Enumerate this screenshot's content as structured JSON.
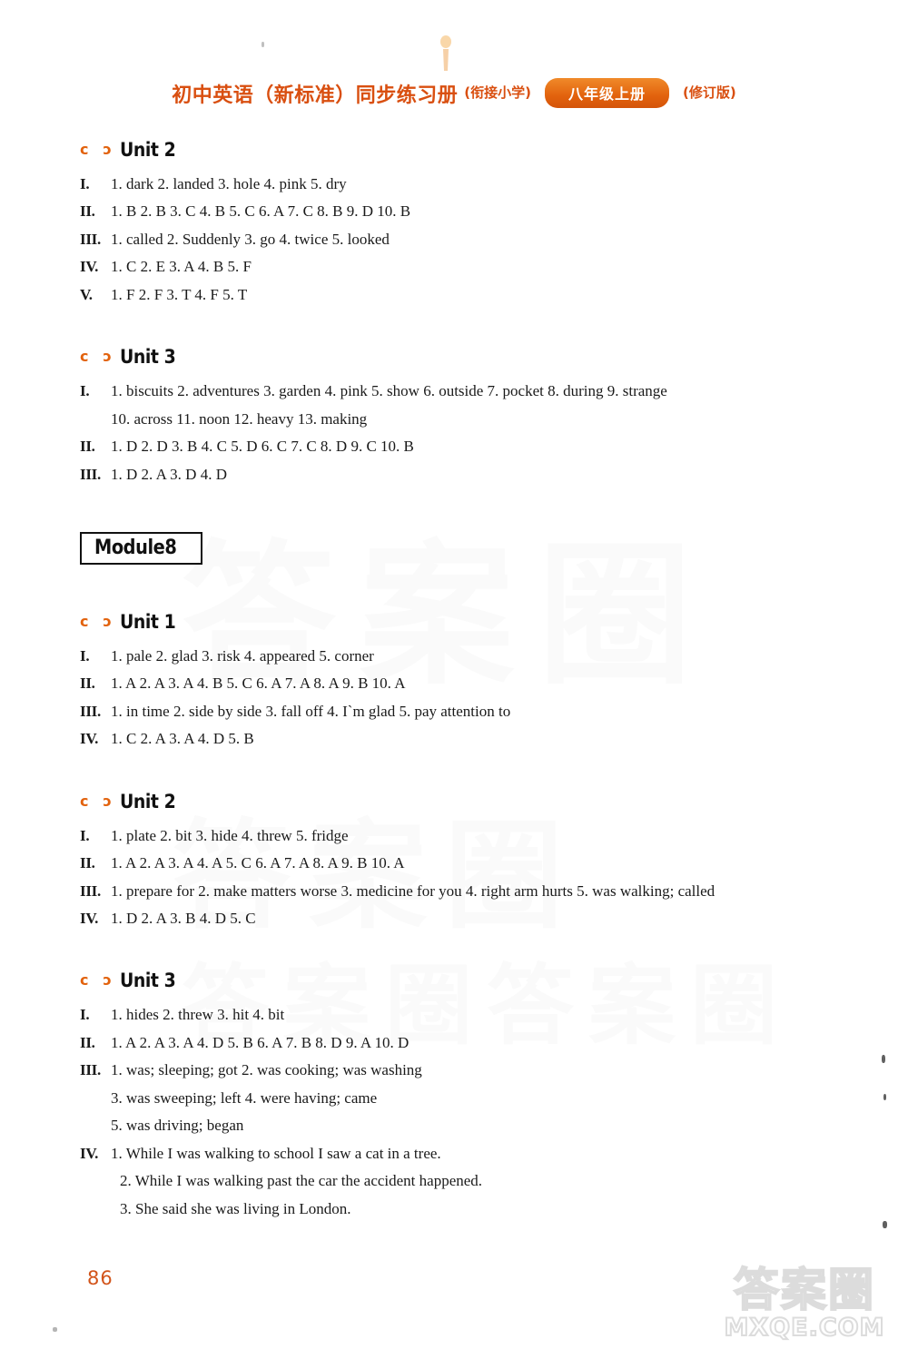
{
  "header": {
    "title_main": "初中英语（新标准）同步练习册",
    "title_sub": "(衔接小学)",
    "badge": "八年级上册",
    "revision": "(修订版)"
  },
  "sections": [
    {
      "kind": "unit",
      "heading": "Unit 2",
      "rows": [
        {
          "num": "I.",
          "text": "1. dark  2. landed  3. hole  4. pink  5. dry"
        },
        {
          "num": "II.",
          "text": "1. B  2. B  3. C  4. B  5. C  6. A  7. C  8. B  9. D  10. B"
        },
        {
          "num": "III.",
          "text": "1. called  2. Suddenly  3. go  4. twice  5. looked"
        },
        {
          "num": "IV.",
          "text": "1. C  2. E  3. A  4. B  5. F"
        },
        {
          "num": "V.",
          "text": "1. F  2. F  3. T  4. F  5. T"
        }
      ]
    },
    {
      "kind": "unit",
      "heading": "Unit 3",
      "rows": [
        {
          "num": "I.",
          "text": "1. biscuits  2. adventures  3. garden  4. pink  5. show  6. outside  7. pocket  8. during  9. strange",
          "cont": [
            "10. across  11. noon  12. heavy  13. making"
          ]
        },
        {
          "num": "II.",
          "text": "1. D  2. D  3. B  4. C  5. D  6. C  7. C  8. D  9. C  10. B"
        },
        {
          "num": "III.",
          "text": "1. D  2. A  3. D  4. D"
        }
      ]
    },
    {
      "kind": "module",
      "heading": "Module8"
    },
    {
      "kind": "unit",
      "heading": "Unit 1",
      "rows": [
        {
          "num": "I.",
          "text": "1. pale  2. glad  3. risk  4. appeared  5. corner"
        },
        {
          "num": "II.",
          "text": "1. A  2. A  3. A  4. B  5. C  6. A  7. A  8. A  9. B  10. A"
        },
        {
          "num": "III.",
          "text": "1. in time  2. side by side  3. fall off  4. I`m glad  5. pay attention to"
        },
        {
          "num": "IV.",
          "text": "1. C  2. A  3. A  4. D  5. B"
        }
      ]
    },
    {
      "kind": "unit",
      "heading": "Unit 2",
      "rows": [
        {
          "num": "I.",
          "text": "1. plate  2. bit  3. hide  4. threw  5. fridge"
        },
        {
          "num": "II.",
          "text": "1. A  2. A  3. A  4. A  5. C  6. A  7. A  8. A  9. B  10. A"
        },
        {
          "num": "III.",
          "text": "1. prepare for  2. make matters worse  3. medicine for you  4. right arm hurts  5. was walking; called"
        },
        {
          "num": "IV.",
          "text": "1. D  2. A  3. B  4. D  5. C"
        }
      ]
    },
    {
      "kind": "unit",
      "heading": "Unit 3",
      "rows": [
        {
          "num": "I.",
          "text": "1. hides  2. threw  3. hit  4. bit"
        },
        {
          "num": "II.",
          "text": "1. A  2. A  3. A  4. D  5. B  6. A  7. B  8. D  9. A  10. D"
        },
        {
          "num": "III.",
          "text": "1. was; sleeping; got      2. was cooking; was washing",
          "cont": [
            "3. was sweeping; left      4. were having; came",
            "5. was driving; began"
          ]
        },
        {
          "num": "IV.",
          "text": "1. While I was walking to school I saw a cat in a tree.",
          "cont": [
            "2. While I was walking past the car the accident happened.",
            "3. She said she was living in London."
          ]
        }
      ]
    }
  ],
  "page_number": "86",
  "watermark": {
    "chinese": "答案圈",
    "domain": "MXQE.COM"
  },
  "ghost_watermark": {
    "line1": "答案圈",
    "line2": "答案圈",
    "line3": "答案圈答案圈"
  },
  "colors": {
    "header_orange": "#d94f10",
    "badge_orange": "#e2620d",
    "page_number_orange": "#d2541a",
    "unit_icon_orange": "#e2620d",
    "text_black": "#1a1a1a"
  },
  "icons": {
    "unit_arc_left": "c",
    "unit_arc_right": "c"
  }
}
